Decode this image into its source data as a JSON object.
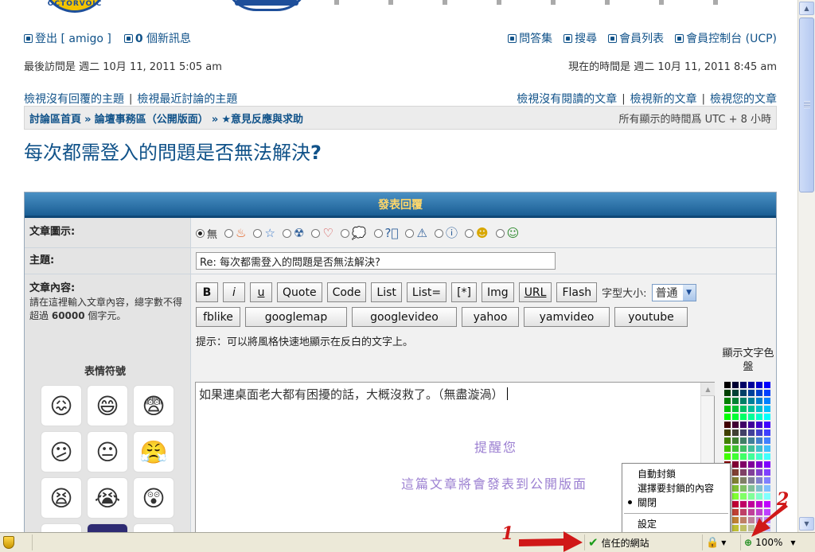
{
  "banner": {
    "logo_text": "OCTORVOIC"
  },
  "userbar": {
    "logout_label": "登出 [ amigo ]",
    "new_messages_count": "0",
    "new_messages_label": "個新訊息",
    "faq": "問答集",
    "search": "搜尋",
    "memberlist": "會員列表",
    "ucp": "會員控制台 (UCP)"
  },
  "times": {
    "last_visit": "最後訪問是 週二 10月 11, 2011 5:05 am",
    "current_time": "現在的時間是 週二 10月 11, 2011 8:45 am"
  },
  "quicklinks": {
    "unanswered": "檢視沒有回覆的主題",
    "active": "檢視最近討論的主題",
    "unread": "檢視沒有閱讀的文章",
    "new_posts": "檢視新的文章",
    "your_posts": "檢視您的文章",
    "sep": "|"
  },
  "breadcrumb": {
    "home": "討論區首頁",
    "forum": "論壇事務區（公開版面）",
    "subforum": "★意見反應與求助",
    "sep": "»",
    "timezone": "所有顯示的時間爲 UTC + 8 小時"
  },
  "topic": {
    "title_text": "每次都需登入的問題是否無法解決",
    "title_mark": "?"
  },
  "form": {
    "header": "發表回覆",
    "icon_label": "文章圖示:",
    "icon_none": "無",
    "subject_label": "主題:",
    "subject_value": "Re: 每次都需登入的問題是否無法解決?",
    "content_label": "文章內容:",
    "content_help": "請在這裡輸入文章內容，總字數不得超過",
    "content_limit": "60000",
    "content_help_end": "個字元。",
    "smilies_title": "表情符號",
    "buttons": [
      "B",
      "i",
      "u",
      "Quote",
      "Code",
      "List",
      "List=",
      "[*]",
      "Img",
      "URL",
      "Flash"
    ],
    "fontsize_label": "字型大小:",
    "fontsize_value": "普通",
    "buttons2": [
      "fblike",
      "googlemap",
      "googlevideo",
      "yahoo",
      "yamvideo",
      "youtube"
    ],
    "hint": "提示：可以將風格快速地顯示在反白的文字上。",
    "palette_title": "顯示文字色盤",
    "text_value": "如果連桌面老大都有困擾的話，大概沒救了。（無盡漩渦）",
    "reminder1": "提醒您",
    "reminder2": "這篇文章將會發表到公開版面"
  },
  "context_menu": {
    "items": [
      "自動封鎖",
      "選擇要封鎖的內容",
      "關閉",
      "設定"
    ],
    "selected": "關閉"
  },
  "statusbar": {
    "zone": "信任的網站",
    "zoom": "100%"
  },
  "annotations": {
    "label1": "1",
    "label2": "2"
  },
  "colors": {
    "link": "#105289",
    "header_gradient_top": "#4a90c4",
    "header_text": "#ffd76a",
    "annotation": "#d01818"
  }
}
